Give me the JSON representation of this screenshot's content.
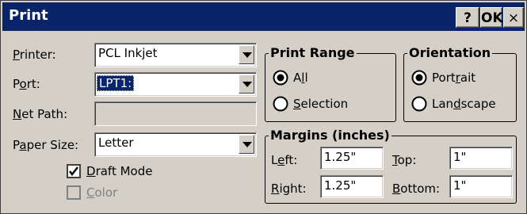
{
  "window": {
    "title": "Print",
    "help_label": "?",
    "ok_label": "OK",
    "close_label": "×"
  },
  "left": {
    "printer_label": "Printer:",
    "printer_value": "PCL Inkjet",
    "port_label": "Port:",
    "port_value": "LPT1:",
    "netpath_label": "Net Path:",
    "netpath_value": "",
    "papersize_label": "Paper Size:",
    "papersize_value": "Letter",
    "draft_label": "Draft Mode",
    "draft_checked": true,
    "color_label": "Color",
    "color_checked": false
  },
  "print_range": {
    "title": "Print Range",
    "all_label": "All",
    "selection_label": "Selection",
    "selected": "All"
  },
  "orientation": {
    "title": "Orientation",
    "portrait_label": "Portrait",
    "landscape_label": "Landscape",
    "selected": "Portrait"
  },
  "margins": {
    "title": "Margins (inches)",
    "left_label": "Left:",
    "left_value": "1.25\"",
    "right_label": "Right:",
    "right_value": "1.25\"",
    "top_label": "Top:",
    "top_value": "1\"",
    "bottom_label": "Bottom:",
    "bottom_value": "1\""
  }
}
